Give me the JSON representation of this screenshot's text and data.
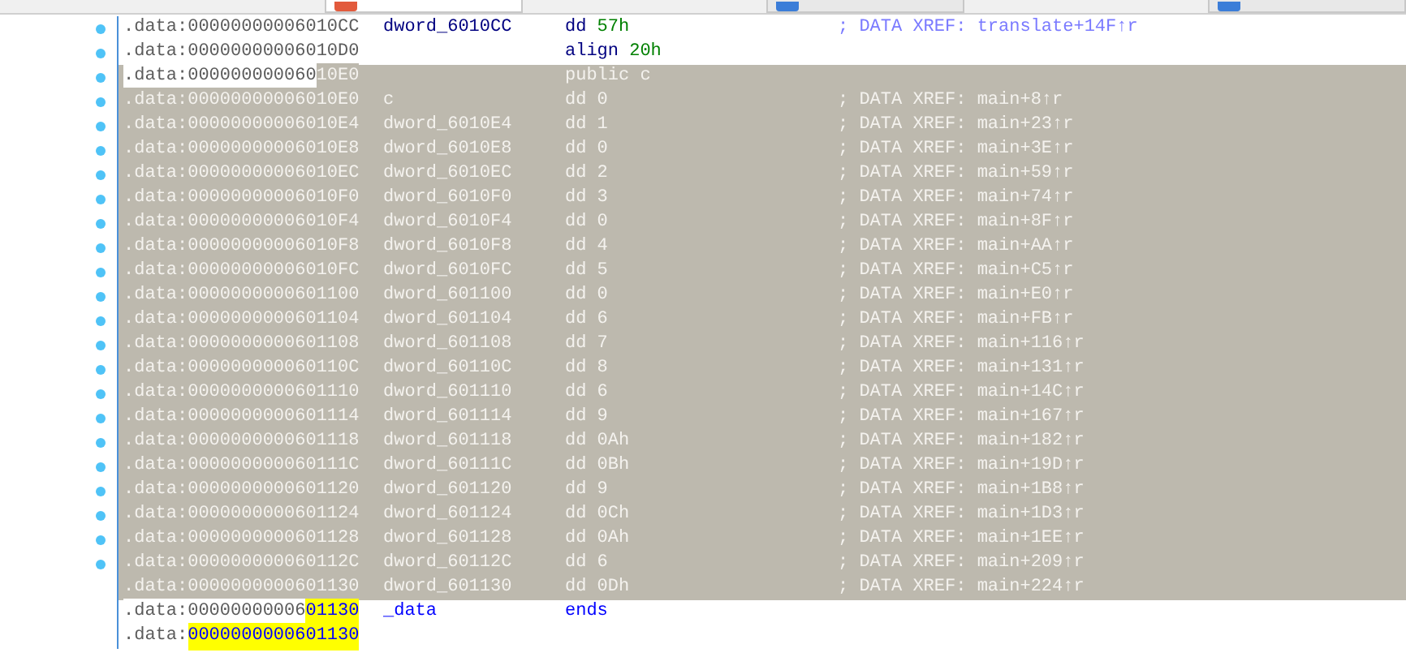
{
  "tab_strip": {
    "tabs": [
      {
        "selected": true
      },
      {
        "selected": false
      },
      {
        "selected": false
      }
    ]
  },
  "listing": {
    "rows": [
      {
        "kind": "data",
        "dot": true,
        "selected": false,
        "address": [
          {
            "text": ".data:00000000006010CC",
            "kind": "plain"
          }
        ],
        "name": "dword_6010CC",
        "mnemonic": "dd",
        "operand": "57h",
        "comment": "; DATA XREF: translate+14F↑r"
      },
      {
        "kind": "data",
        "dot": true,
        "selected": false,
        "address": [
          {
            "text": ".data:00000000006010D0",
            "kind": "plain"
          }
        ],
        "mnemonic": "align",
        "operand": "20h"
      },
      {
        "kind": "data",
        "dot": true,
        "selected": true,
        "address": [
          {
            "text": ".data:000000000060",
            "kind": "plain"
          },
          {
            "text": "10E0",
            "kind": "selected"
          }
        ],
        "mnemonic": "public",
        "operand": "c"
      },
      {
        "kind": "data",
        "dot": true,
        "selected": true,
        "address": [
          {
            "text": ".data:00000000006010E0",
            "kind": "selected"
          }
        ],
        "name": "c",
        "mnemonic": "dd",
        "operand": "0",
        "comment": "; DATA XREF: main+8↑r"
      },
      {
        "kind": "data",
        "dot": true,
        "selected": true,
        "address": [
          {
            "text": ".data:00000000006010E4",
            "kind": "selected"
          }
        ],
        "name": "dword_6010E4",
        "mnemonic": "dd",
        "operand": "1",
        "comment": "; DATA XREF: main+23↑r"
      },
      {
        "kind": "data",
        "dot": true,
        "selected": true,
        "address": [
          {
            "text": ".data:00000000006010E8",
            "kind": "selected"
          }
        ],
        "name": "dword_6010E8",
        "mnemonic": "dd",
        "operand": "0",
        "comment": "; DATA XREF: main+3E↑r"
      },
      {
        "kind": "data",
        "dot": true,
        "selected": true,
        "address": [
          {
            "text": ".data:00000000006010EC",
            "kind": "selected"
          }
        ],
        "name": "dword_6010EC",
        "mnemonic": "dd",
        "operand": "2",
        "comment": "; DATA XREF: main+59↑r"
      },
      {
        "kind": "data",
        "dot": true,
        "selected": true,
        "address": [
          {
            "text": ".data:00000000006010F0",
            "kind": "selected"
          }
        ],
        "name": "dword_6010F0",
        "mnemonic": "dd",
        "operand": "3",
        "comment": "; DATA XREF: main+74↑r"
      },
      {
        "kind": "data",
        "dot": true,
        "selected": true,
        "address": [
          {
            "text": ".data:00000000006010F4",
            "kind": "selected"
          }
        ],
        "name": "dword_6010F4",
        "mnemonic": "dd",
        "operand": "0",
        "comment": "; DATA XREF: main+8F↑r"
      },
      {
        "kind": "data",
        "dot": true,
        "selected": true,
        "address": [
          {
            "text": ".data:00000000006010F8",
            "kind": "selected"
          }
        ],
        "name": "dword_6010F8",
        "mnemonic": "dd",
        "operand": "4",
        "comment": "; DATA XREF: main+AA↑r"
      },
      {
        "kind": "data",
        "dot": true,
        "selected": true,
        "address": [
          {
            "text": ".data:00000000006010FC",
            "kind": "selected"
          }
        ],
        "name": "dword_6010FC",
        "mnemonic": "dd",
        "operand": "5",
        "comment": "; DATA XREF: main+C5↑r"
      },
      {
        "kind": "data",
        "dot": true,
        "selected": true,
        "address": [
          {
            "text": ".data:0000000000601100",
            "kind": "selected"
          }
        ],
        "name": "dword_601100",
        "mnemonic": "dd",
        "operand": "0",
        "comment": "; DATA XREF: main+E0↑r"
      },
      {
        "kind": "data",
        "dot": true,
        "selected": true,
        "address": [
          {
            "text": ".data:0000000000601104",
            "kind": "selected"
          }
        ],
        "name": "dword_601104",
        "mnemonic": "dd",
        "operand": "6",
        "comment": "; DATA XREF: main+FB↑r"
      },
      {
        "kind": "data",
        "dot": true,
        "selected": true,
        "address": [
          {
            "text": ".data:0000000000601108",
            "kind": "selected"
          }
        ],
        "name": "dword_601108",
        "mnemonic": "dd",
        "operand": "7",
        "comment": "; DATA XREF: main+116↑r"
      },
      {
        "kind": "data",
        "dot": true,
        "selected": true,
        "address": [
          {
            "text": ".data:000000000060110C",
            "kind": "selected"
          }
        ],
        "name": "dword_60110C",
        "mnemonic": "dd",
        "operand": "8",
        "comment": "; DATA XREF: main+131↑r"
      },
      {
        "kind": "data",
        "dot": true,
        "selected": true,
        "address": [
          {
            "text": ".data:0000000000601110",
            "kind": "selected"
          }
        ],
        "name": "dword_601110",
        "mnemonic": "dd",
        "operand": "6",
        "comment": "; DATA XREF: main+14C↑r"
      },
      {
        "kind": "data",
        "dot": true,
        "selected": true,
        "address": [
          {
            "text": ".data:0000000000601114",
            "kind": "selected"
          }
        ],
        "name": "dword_601114",
        "mnemonic": "dd",
        "operand": "9",
        "comment": "; DATA XREF: main+167↑r"
      },
      {
        "kind": "data",
        "dot": true,
        "selected": true,
        "address": [
          {
            "text": ".data:0000000000601118",
            "kind": "selected"
          }
        ],
        "name": "dword_601118",
        "mnemonic": "dd",
        "operand": "0Ah",
        "comment": "; DATA XREF: main+182↑r"
      },
      {
        "kind": "data",
        "dot": true,
        "selected": true,
        "address": [
          {
            "text": ".data:000000000060111C",
            "kind": "selected"
          }
        ],
        "name": "dword_60111C",
        "mnemonic": "dd",
        "operand": "0Bh",
        "comment": "; DATA XREF: main+19D↑r"
      },
      {
        "kind": "data",
        "dot": true,
        "selected": true,
        "address": [
          {
            "text": ".data:0000000000601120",
            "kind": "selected"
          }
        ],
        "name": "dword_601120",
        "mnemonic": "dd",
        "operand": "9",
        "comment": "; DATA XREF: main+1B8↑r"
      },
      {
        "kind": "data",
        "dot": true,
        "selected": true,
        "address": [
          {
            "text": ".data:0000000000601124",
            "kind": "selected"
          }
        ],
        "name": "dword_601124",
        "mnemonic": "dd",
        "operand": "0Ch",
        "comment": "; DATA XREF: main+1D3↑r"
      },
      {
        "kind": "data",
        "dot": true,
        "selected": true,
        "address": [
          {
            "text": ".data:0000000000601128",
            "kind": "selected"
          }
        ],
        "name": "dword_601128",
        "mnemonic": "dd",
        "operand": "0Ah",
        "comment": "; DATA XREF: main+1EE↑r"
      },
      {
        "kind": "data",
        "dot": true,
        "selected": true,
        "address": [
          {
            "text": ".data:000000000060112C",
            "kind": "selected"
          }
        ],
        "name": "dword_60112C",
        "mnemonic": "dd",
        "operand": "6",
        "comment": "; DATA XREF: main+209↑r"
      },
      {
        "kind": "data",
        "dot": false,
        "selected": true,
        "address": [
          {
            "text": ".data:0000000000601130",
            "kind": "selected"
          }
        ],
        "name": "dword_601130",
        "mnemonic": "dd",
        "operand": "0Dh",
        "comment": "; DATA XREF: main+224↑r"
      },
      {
        "kind": "segment_end",
        "dot": false,
        "selected": false,
        "address": [
          {
            "text": ".data:00000000006",
            "kind": "plain"
          },
          {
            "text": "01130",
            "kind": "search_hit"
          }
        ],
        "name": "_data",
        "mnemonic": "ends"
      },
      {
        "kind": "data",
        "dot": false,
        "selected": false,
        "address": [
          {
            "text": ".data:",
            "kind": "plain"
          },
          {
            "text": "0000000000601130",
            "kind": "search_hit"
          }
        ]
      }
    ]
  }
}
